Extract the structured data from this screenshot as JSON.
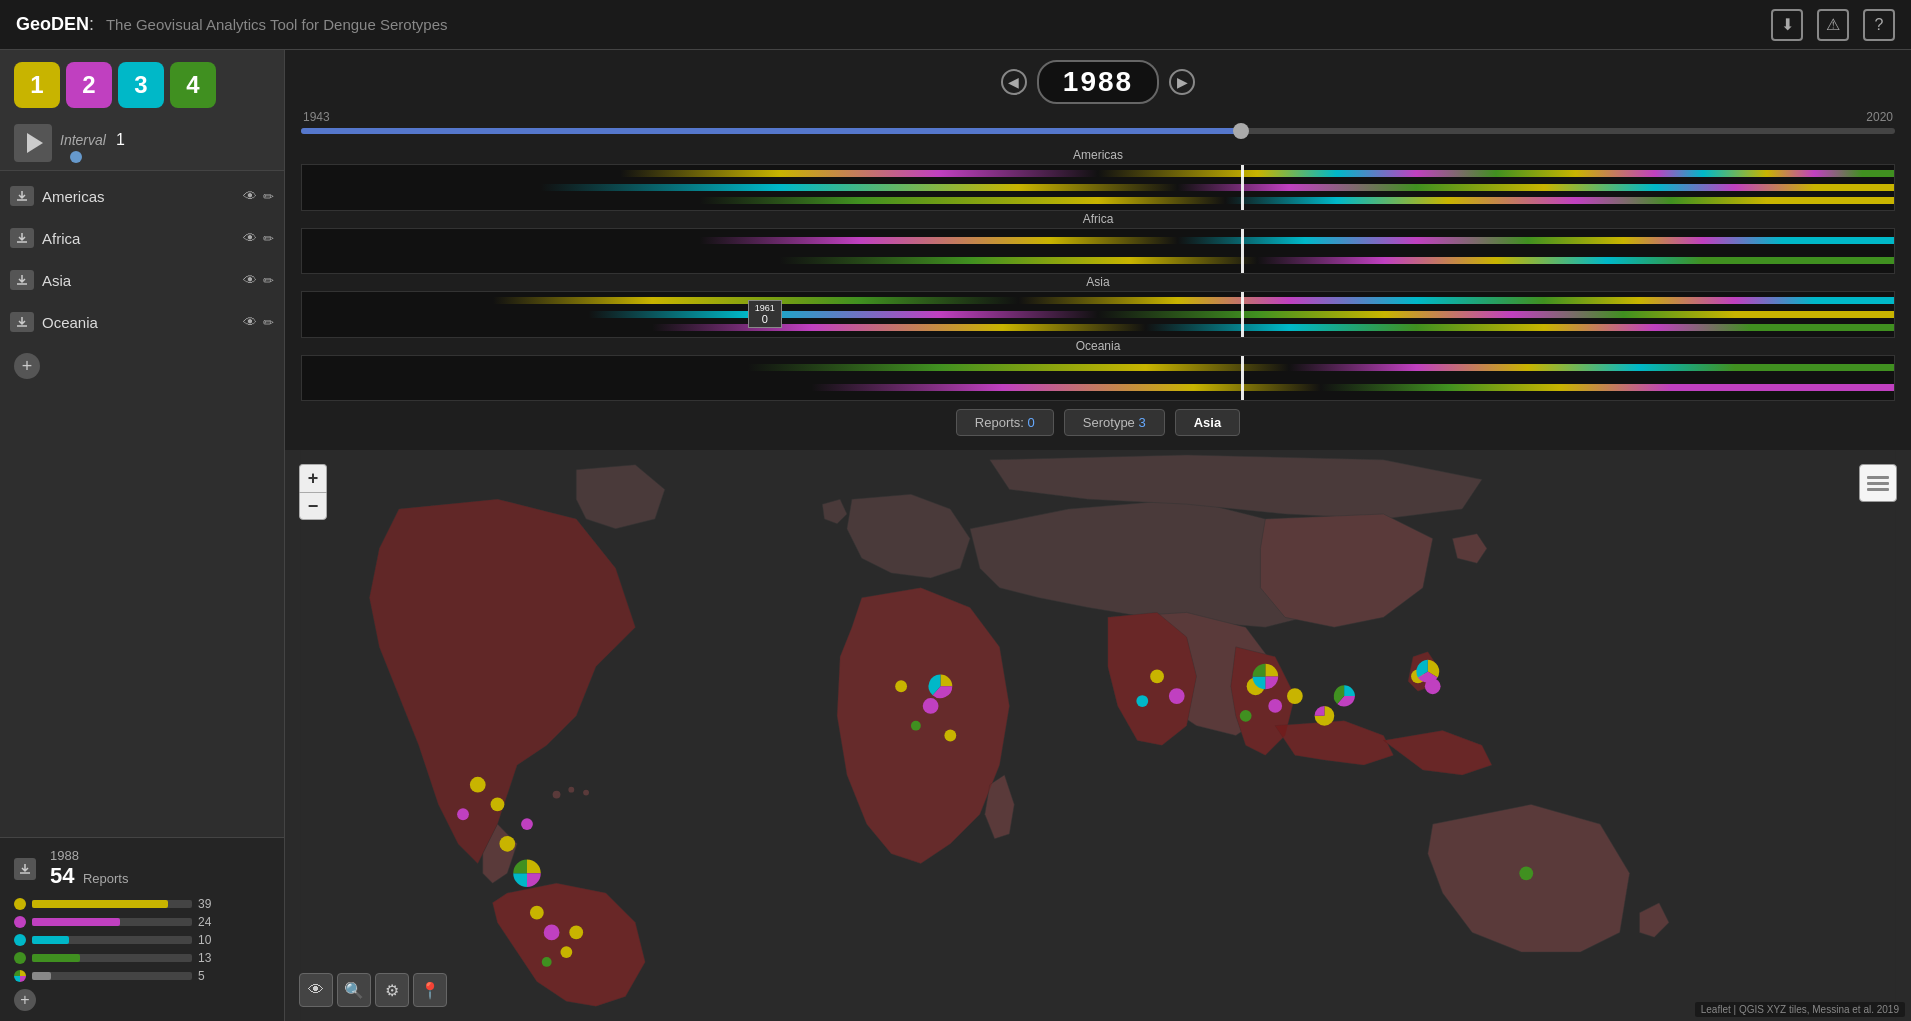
{
  "app": {
    "title_geo": "GeoDEN",
    "title_sep": ":",
    "title_sub": " The Geovisual Analytics Tool for Dengue Serotypes"
  },
  "header": {
    "icons": [
      "download-icon",
      "warning-icon",
      "help-icon"
    ]
  },
  "serotypes": [
    {
      "label": "1",
      "class": "s1"
    },
    {
      "label": "2",
      "class": "s2"
    },
    {
      "label": "3",
      "class": "s3"
    },
    {
      "label": "4",
      "class": "s4"
    }
  ],
  "playback": {
    "interval_label": "Interval",
    "interval_value": "1"
  },
  "regions": [
    {
      "name": "Americas"
    },
    {
      "name": "Africa"
    },
    {
      "name": "Asia"
    },
    {
      "name": "Oceania"
    }
  ],
  "timeline": {
    "year": "1988",
    "year_start": "1943",
    "year_end": "2020",
    "slider_pct": 59,
    "region_labels": [
      "Americas",
      "Africa",
      "Asia",
      "Oceania"
    ],
    "mini_year": "1961",
    "mini_val": "0"
  },
  "footer_buttons": [
    {
      "label": "Reports: ",
      "value": "0",
      "active": false
    },
    {
      "label": "Serotype ",
      "value": "3",
      "active": false
    },
    {
      "label": "Asia",
      "value": "",
      "active": true
    }
  ],
  "stats": {
    "download_icon": "↓",
    "year": "1988",
    "count": "54",
    "reports_label": "Reports"
  },
  "legend": [
    {
      "color": "#c8b400",
      "bar_pct": 85,
      "count": "39"
    },
    {
      "color": "#c040c0",
      "bar_pct": 55,
      "count": "24"
    },
    {
      "color": "#00b8c8",
      "bar_pct": 23,
      "count": "10"
    },
    {
      "color": "#409020",
      "bar_pct": 30,
      "count": "13"
    },
    {
      "multi": true,
      "bar_pct": 12,
      "count": "5"
    }
  ],
  "map": {
    "zoom_in": "+",
    "zoom_out": "−",
    "attribution": "Leaflet | QGIS XYZ tiles, Messina et al. 2019"
  }
}
